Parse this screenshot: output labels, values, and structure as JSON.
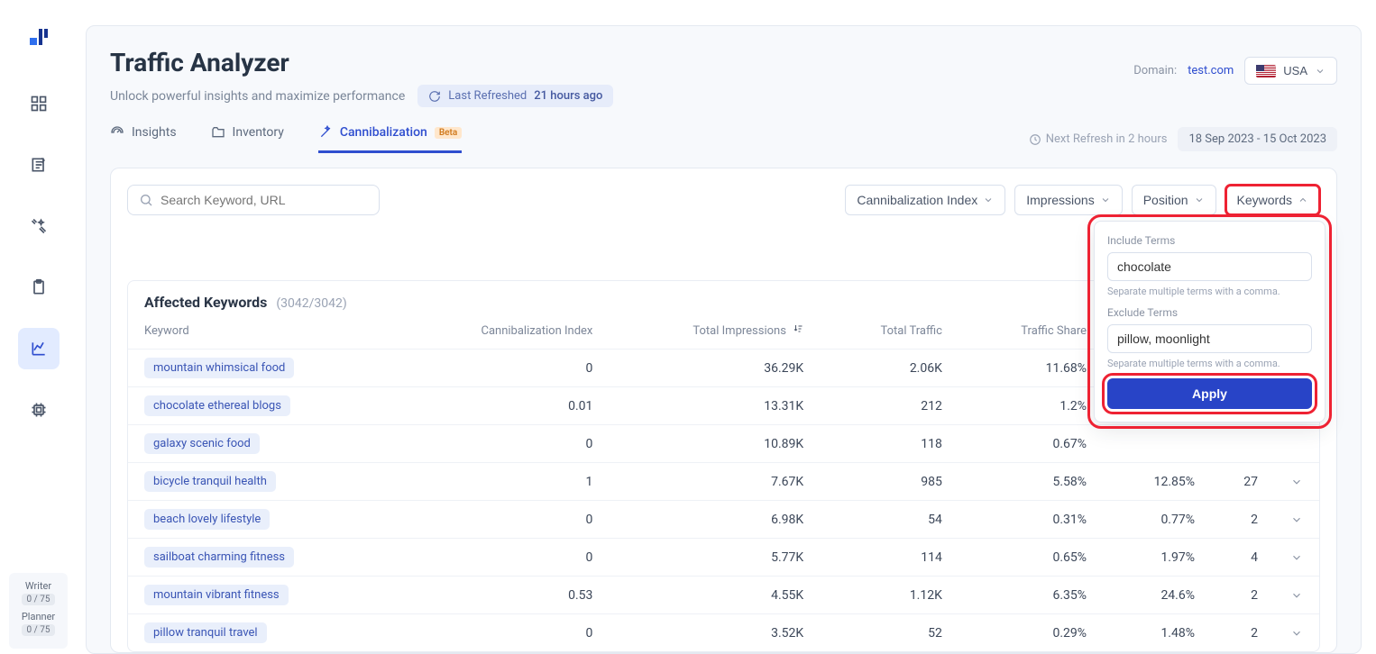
{
  "sidebar": {
    "credits": [
      {
        "label": "Writer",
        "count": "0 / 75"
      },
      {
        "label": "Planner",
        "count": "0 / 75"
      }
    ]
  },
  "header": {
    "title": "Traffic Analyzer",
    "subtitle": "Unlock powerful insights and maximize performance",
    "refresh_label": "Last Refreshed",
    "refresh_value": "21 hours ago",
    "domain_label": "Domain:",
    "domain_value": "test.com",
    "country": "USA"
  },
  "tabs": {
    "insights": "Insights",
    "inventory": "Inventory",
    "cannibalization": "Cannibalization",
    "beta": "Beta",
    "next_refresh": "Next Refresh in 2 hours",
    "date_range": "18 Sep 2023 - 15 Oct 2023"
  },
  "filters": {
    "search_placeholder": "Search Keyword, URL",
    "cannibalization_index": "Cannibalization Index",
    "impressions": "Impressions",
    "position": "Position",
    "keywords": "Keywords"
  },
  "popover": {
    "include_label": "Include Terms",
    "include_value": "chocolate",
    "exclude_label": "Exclude Terms",
    "exclude_value": "pillow, moonlight",
    "hint": "Separate multiple terms with a comma.",
    "apply": "Apply"
  },
  "table": {
    "title": "Affected Keywords",
    "count": "(3042/3042)",
    "columns": {
      "keyword": "Keyword",
      "cindex": "Cannibalization Index",
      "impressions": "Total Impressions",
      "traffic": "Total Traffic",
      "share": "Traffic Share",
      "col6": "",
      "col7": ""
    },
    "rows": [
      {
        "kw": "mountain whimsical food",
        "ci": "0",
        "imp": "36.29K",
        "tr": "2.06K",
        "sh": "11.68%",
        "c6": "",
        "c7": ""
      },
      {
        "kw": "chocolate ethereal blogs",
        "ci": "0.01",
        "imp": "13.31K",
        "tr": "212",
        "sh": "1.2%",
        "c6": "",
        "c7": ""
      },
      {
        "kw": "galaxy scenic food",
        "ci": "0",
        "imp": "10.89K",
        "tr": "118",
        "sh": "0.67%",
        "c6": "",
        "c7": ""
      },
      {
        "kw": "bicycle tranquil health",
        "ci": "1",
        "imp": "7.67K",
        "tr": "985",
        "sh": "5.58%",
        "c6": "12.85%",
        "c7": "27"
      },
      {
        "kw": "beach lovely lifestyle",
        "ci": "0",
        "imp": "6.98K",
        "tr": "54",
        "sh": "0.31%",
        "c6": "0.77%",
        "c7": "2"
      },
      {
        "kw": "sailboat charming fitness",
        "ci": "0",
        "imp": "5.77K",
        "tr": "114",
        "sh": "0.65%",
        "c6": "1.97%",
        "c7": "4"
      },
      {
        "kw": "mountain vibrant fitness",
        "ci": "0.53",
        "imp": "4.55K",
        "tr": "1.12K",
        "sh": "6.35%",
        "c6": "24.6%",
        "c7": "2"
      },
      {
        "kw": "pillow tranquil travel",
        "ci": "0",
        "imp": "3.52K",
        "tr": "52",
        "sh": "0.29%",
        "c6": "1.48%",
        "c7": "2"
      }
    ]
  }
}
